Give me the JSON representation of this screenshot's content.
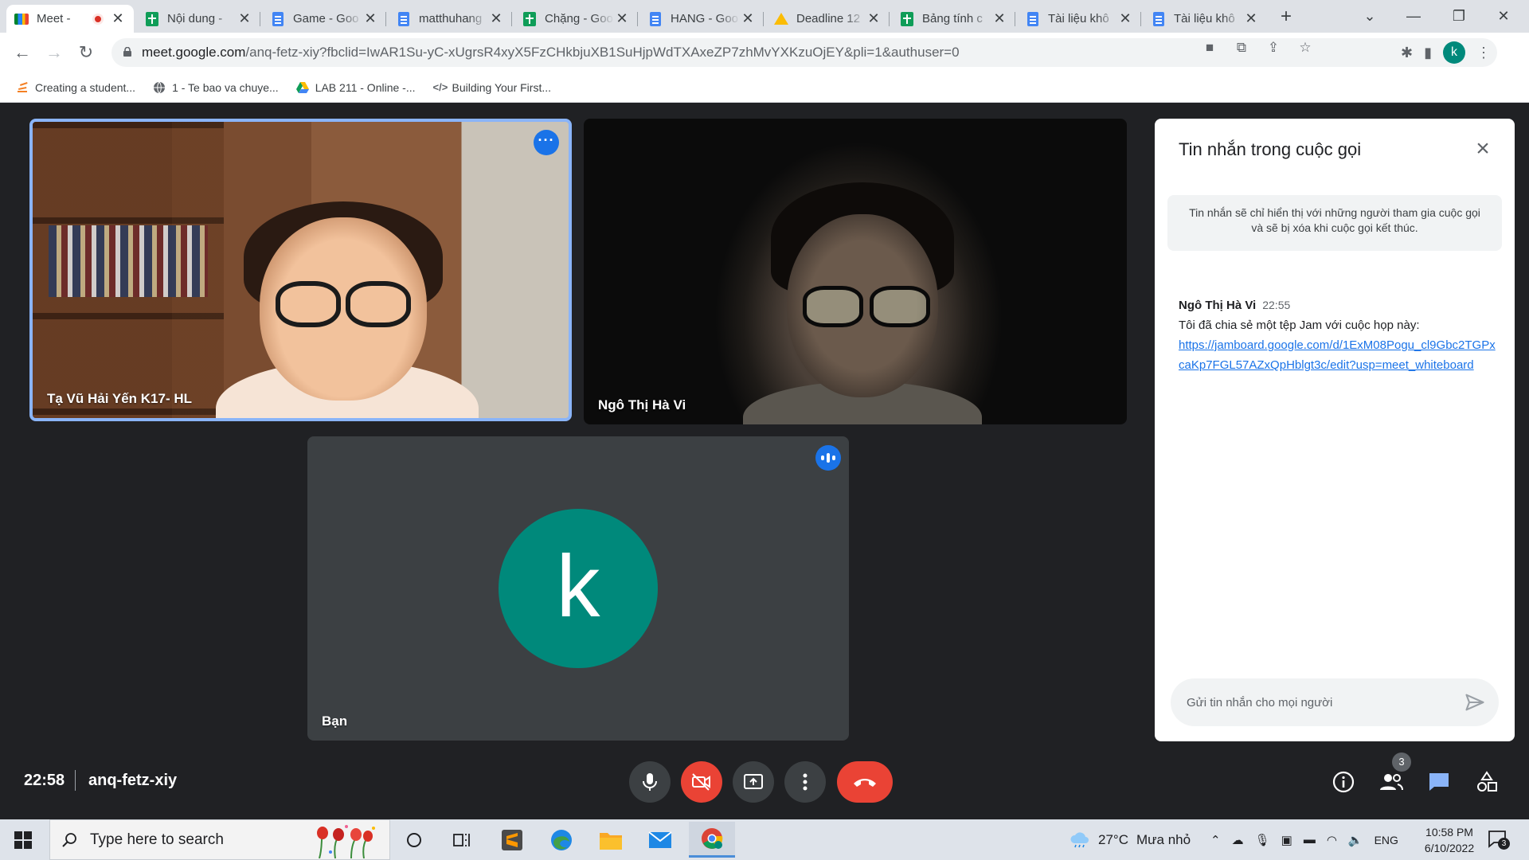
{
  "browser": {
    "tabs": [
      {
        "title": "Meet -",
        "icon": "meet-icon",
        "recording": true,
        "active": true
      },
      {
        "title": "Nội dung -",
        "icon": "sheets-icon"
      },
      {
        "title": "Game - Goo",
        "icon": "docs-icon"
      },
      {
        "title": "matthuhang",
        "icon": "docs-icon"
      },
      {
        "title": "Chặng - Goo",
        "icon": "sheets-icon"
      },
      {
        "title": "HANG - Goo",
        "icon": "docs-icon"
      },
      {
        "title": "Deadline 12",
        "icon": "drive-icon"
      },
      {
        "title": "Bảng tính c",
        "icon": "sheets-icon"
      },
      {
        "title": "Tài liệu khô",
        "icon": "docs-icon"
      },
      {
        "title": "Tài liệu khô",
        "icon": "docs-icon"
      }
    ],
    "url_host": "meet.google.com",
    "url_rest": "/anq-fetz-xiy?fbclid=IwAR1Su-yC-xUgrsR4xyX5FzCHkbjuXB1SuHjpWdTXAxeZP7zhMvYXKzuOjEY&pli=1&authuser=0",
    "profile_initial": "k",
    "bookmarks": [
      {
        "label": "Creating a student...",
        "icon": "stack-icon"
      },
      {
        "label": "1 - Te bao va chuye...",
        "icon": "globe-icon"
      },
      {
        "label": "LAB 211 - Online -...",
        "icon": "drive-icon"
      },
      {
        "label": "Building Your First...",
        "icon": "code-icon"
      }
    ]
  },
  "meet": {
    "participants": [
      {
        "name": "Tạ Vũ Hải Yến K17- HL"
      },
      {
        "name": "Ngô Thị Hà Vi"
      },
      {
        "name": "Bạn",
        "avatar_initial": "k"
      }
    ],
    "chat": {
      "title": "Tin nhắn trong cuộc gọi",
      "notice": "Tin nhắn sẽ chỉ hiển thị với những người tham gia cuộc gọi và sẽ bị xóa khi cuộc gọi kết thúc.",
      "messages": [
        {
          "sender": "Ngô Thị Hà Vi",
          "time": "22:55",
          "text": "Tôi đã chia sẻ một tệp Jam với cuộc họp này:",
          "link": "https://jamboard.google.com/d/1ExM08Pogu_cl9Gbc2TGPxcaKp7FGL57AZxQpHblgt3c/edit?usp=meet_whiteboard"
        }
      ],
      "input_placeholder": "Gửi tin nhắn cho mọi người"
    },
    "time": "22:58",
    "meeting_code": "anq-fetz-xiy",
    "people_count": "3"
  },
  "taskbar": {
    "search_placeholder": "Type here to search",
    "weather_temp": "27°C",
    "weather_desc": "Mưa nhỏ",
    "language": "ENG",
    "clock_time": "10:58 PM",
    "clock_date": "6/10/2022",
    "notification_count": "3"
  },
  "colors": {
    "meet_bg": "#202124",
    "tile_bg": "#3c4043",
    "accent_blue": "#1a73e8",
    "hangup_red": "#ea4335",
    "avatar_teal": "#00897b"
  }
}
